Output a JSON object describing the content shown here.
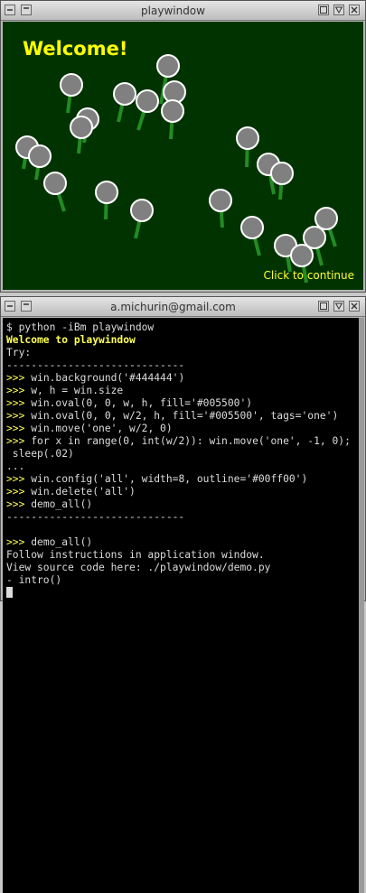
{
  "play_window": {
    "title": "playwindow",
    "welcome_text": "Welcome!",
    "continue_text": "Click to continue",
    "background_color": "#003300",
    "flower_head_color": "#808080",
    "flower_outline_color": "#ffffff",
    "flower_stem_color": "#228b22"
  },
  "terminal_window": {
    "title": "a.michurin@gmail.com",
    "lines": [
      {
        "text": "$ python -iBm playwindow",
        "style": "normal"
      },
      {
        "text": "Welcome to playwindow",
        "style": "yellow-bold"
      },
      {
        "text": "Try:",
        "style": "normal"
      },
      {
        "text": "-----------------------------",
        "style": "normal"
      },
      {
        "prompt": ">>> ",
        "text": "win.background('#444444')",
        "style": "prompt"
      },
      {
        "prompt": ">>> ",
        "text": "w, h = win.size",
        "style": "prompt"
      },
      {
        "prompt": ">>> ",
        "text": "win.oval(0, 0, w, h, fill='#005500')",
        "style": "prompt"
      },
      {
        "prompt": ">>> ",
        "text": "win.oval(0, 0, w/2, h, fill='#005500', tags='one')",
        "style": "prompt"
      },
      {
        "prompt": ">>> ",
        "text": "win.move('one', w/2, 0)",
        "style": "prompt"
      },
      {
        "prompt": ">>> ",
        "text": "for x in range(0, int(w/2)): win.move('one', -1, 0);",
        "style": "prompt"
      },
      {
        "text": " sleep(.02)",
        "style": "normal"
      },
      {
        "text": "...",
        "style": "normal"
      },
      {
        "prompt": ">>> ",
        "text": "win.config('all', width=8, outline='#00ff00')",
        "style": "prompt"
      },
      {
        "prompt": ">>> ",
        "text": "win.delete('all')",
        "style": "prompt"
      },
      {
        "prompt": ">>> ",
        "text": "demo_all()",
        "style": "prompt"
      },
      {
        "text": "-----------------------------",
        "style": "normal"
      },
      {
        "text": "",
        "style": "normal"
      },
      {
        "prompt": ">>> ",
        "text": "demo_all()",
        "style": "prompt"
      },
      {
        "text": "Follow instructions in application window.",
        "style": "normal"
      },
      {
        "text": "View source code here: ./playwindow/demo.py",
        "style": "normal"
      },
      {
        "text": "- intro()",
        "style": "normal"
      }
    ]
  }
}
